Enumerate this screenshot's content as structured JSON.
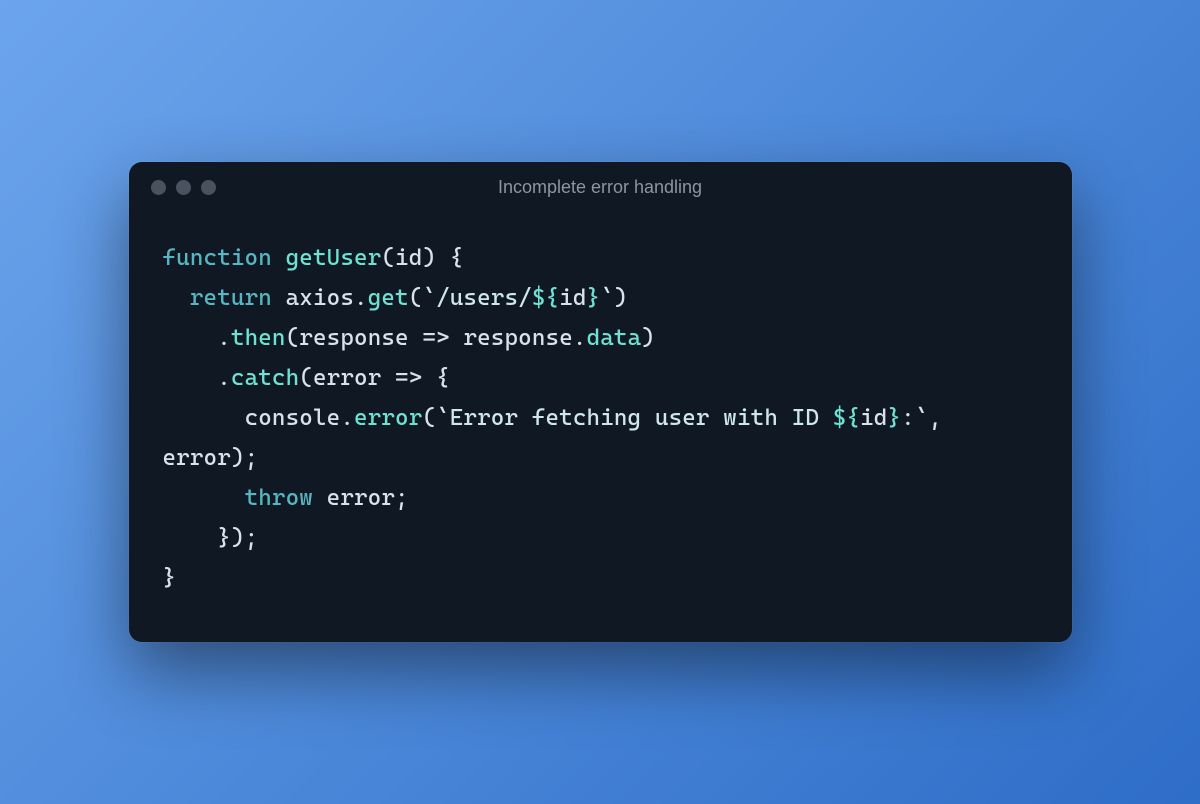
{
  "window": {
    "title": "Incomplete error handling"
  },
  "code": {
    "tokens": [
      {
        "t": "function",
        "c": "tok-keyword"
      },
      {
        "t": " ",
        "c": ""
      },
      {
        "t": "getUser",
        "c": "tok-func"
      },
      {
        "t": "(",
        "c": "tok-punct"
      },
      {
        "t": "id",
        "c": "tok-param"
      },
      {
        "t": ") {",
        "c": "tok-punct"
      },
      {
        "t": "\n  ",
        "c": ""
      },
      {
        "t": "return",
        "c": "tok-keyword"
      },
      {
        "t": " ",
        "c": ""
      },
      {
        "t": "axios",
        "c": "tok-ident"
      },
      {
        "t": ".",
        "c": "tok-punct"
      },
      {
        "t": "get",
        "c": "tok-prop"
      },
      {
        "t": "(",
        "c": "tok-punct"
      },
      {
        "t": "`/users/",
        "c": "tok-string"
      },
      {
        "t": "${",
        "c": "tok-interp"
      },
      {
        "t": "id",
        "c": "tok-ident"
      },
      {
        "t": "}",
        "c": "tok-interp"
      },
      {
        "t": "`",
        "c": "tok-string"
      },
      {
        "t": ")",
        "c": "tok-punct"
      },
      {
        "t": "\n    .",
        "c": "tok-punct"
      },
      {
        "t": "then",
        "c": "tok-prop"
      },
      {
        "t": "(",
        "c": "tok-punct"
      },
      {
        "t": "response",
        "c": "tok-param"
      },
      {
        "t": " => ",
        "c": "tok-punct"
      },
      {
        "t": "response",
        "c": "tok-ident"
      },
      {
        "t": ".",
        "c": "tok-punct"
      },
      {
        "t": "data",
        "c": "tok-prop"
      },
      {
        "t": ")",
        "c": "tok-punct"
      },
      {
        "t": "\n    .",
        "c": "tok-punct"
      },
      {
        "t": "catch",
        "c": "tok-prop"
      },
      {
        "t": "(",
        "c": "tok-punct"
      },
      {
        "t": "error",
        "c": "tok-param"
      },
      {
        "t": " => {",
        "c": "tok-punct"
      },
      {
        "t": "\n      ",
        "c": ""
      },
      {
        "t": "console",
        "c": "tok-ident"
      },
      {
        "t": ".",
        "c": "tok-punct"
      },
      {
        "t": "error",
        "c": "tok-prop"
      },
      {
        "t": "(",
        "c": "tok-punct"
      },
      {
        "t": "`Error fetching user with ID ",
        "c": "tok-string"
      },
      {
        "t": "${",
        "c": "tok-interp"
      },
      {
        "t": "id",
        "c": "tok-ident"
      },
      {
        "t": "}",
        "c": "tok-interp"
      },
      {
        "t": ":`",
        "c": "tok-string"
      },
      {
        "t": ", ",
        "c": "tok-punct"
      },
      {
        "t": "error",
        "c": "tok-ident"
      },
      {
        "t": ");",
        "c": "tok-punct"
      },
      {
        "t": "\n      ",
        "c": ""
      },
      {
        "t": "throw",
        "c": "tok-keyword"
      },
      {
        "t": " ",
        "c": ""
      },
      {
        "t": "error",
        "c": "tok-ident"
      },
      {
        "t": ";",
        "c": "tok-punct"
      },
      {
        "t": "\n    });",
        "c": "tok-punct"
      },
      {
        "t": "\n}",
        "c": "tok-punct"
      }
    ]
  }
}
